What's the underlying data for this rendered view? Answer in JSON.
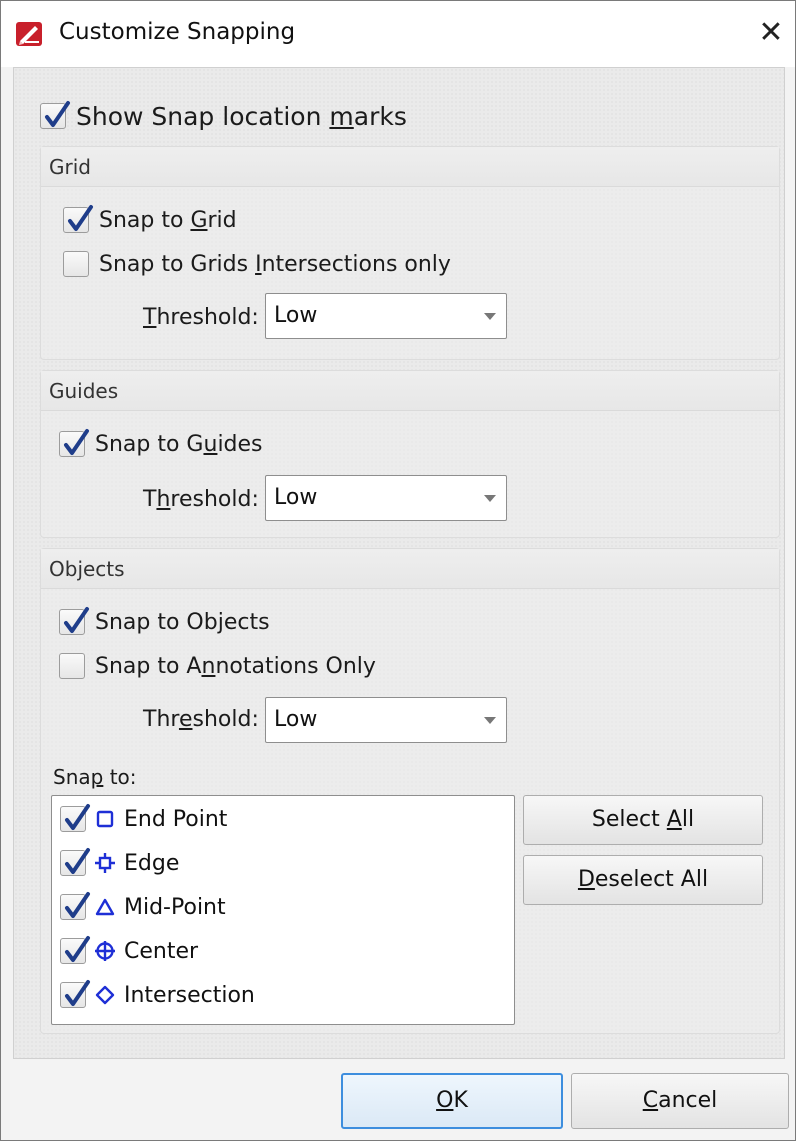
{
  "window": {
    "title": "Customize Snapping",
    "close_glyph": "✕",
    "app_icon": "pdf-xchange-logo-icon"
  },
  "show_marks": {
    "label_pre": "Show Snap location ",
    "label_ul": "m",
    "label_post": "arks",
    "checked": true
  },
  "grid": {
    "header": "Grid",
    "snap_to_grid": {
      "pre": "Snap to ",
      "ul": "G",
      "post": "rid",
      "checked": true
    },
    "snap_intersections": {
      "pre": "Snap to Grids ",
      "ul": "I",
      "post": "ntersections only",
      "checked": false
    },
    "threshold": {
      "pre": "",
      "ul": "T",
      "post": "hreshold:",
      "value": "Low"
    }
  },
  "guides": {
    "header": "Guides",
    "snap_to_guides": {
      "pre": "Snap to G",
      "ul": "u",
      "post": "ides",
      "checked": true
    },
    "threshold": {
      "pre": "T",
      "ul": "h",
      "post": "reshold:",
      "value": "Low"
    }
  },
  "objects": {
    "header": "Objects",
    "snap_to_objects": {
      "pre": "Snap to Ob",
      "ul": "j",
      "post": "ects",
      "checked": true
    },
    "snap_annotations": {
      "pre": "Snap to A",
      "ul": "n",
      "post": "notations Only",
      "checked": false
    },
    "threshold": {
      "pre": "Thr",
      "ul": "e",
      "post": "shold:",
      "value": "Low"
    },
    "snap_to_label": {
      "pre": "Sna",
      "ul": "p",
      "post": " to:"
    },
    "snap_points": [
      {
        "label": "End Point",
        "icon": "square-icon",
        "checked": true
      },
      {
        "label": "Edge",
        "icon": "edge-crosshair-icon",
        "checked": true
      },
      {
        "label": "Mid-Point",
        "icon": "triangle-icon",
        "checked": true
      },
      {
        "label": "Center",
        "icon": "circle-cross-icon",
        "checked": true
      },
      {
        "label": "Intersection",
        "icon": "diamond-icon",
        "checked": true
      }
    ],
    "select_all": {
      "pre": "Select ",
      "ul": "A",
      "post": "ll"
    },
    "deselect_all": {
      "pre": "",
      "ul": "D",
      "post": "eselect All"
    }
  },
  "footer": {
    "ok": {
      "pre": "",
      "ul": "O",
      "post": "K"
    },
    "cancel": {
      "pre": "",
      "ul": "C",
      "post": "ancel"
    }
  },
  "colors": {
    "accent_blue": "#1e2fd6",
    "check_blue": "#1f3d8a",
    "default_button_border": "#3d8ede"
  }
}
